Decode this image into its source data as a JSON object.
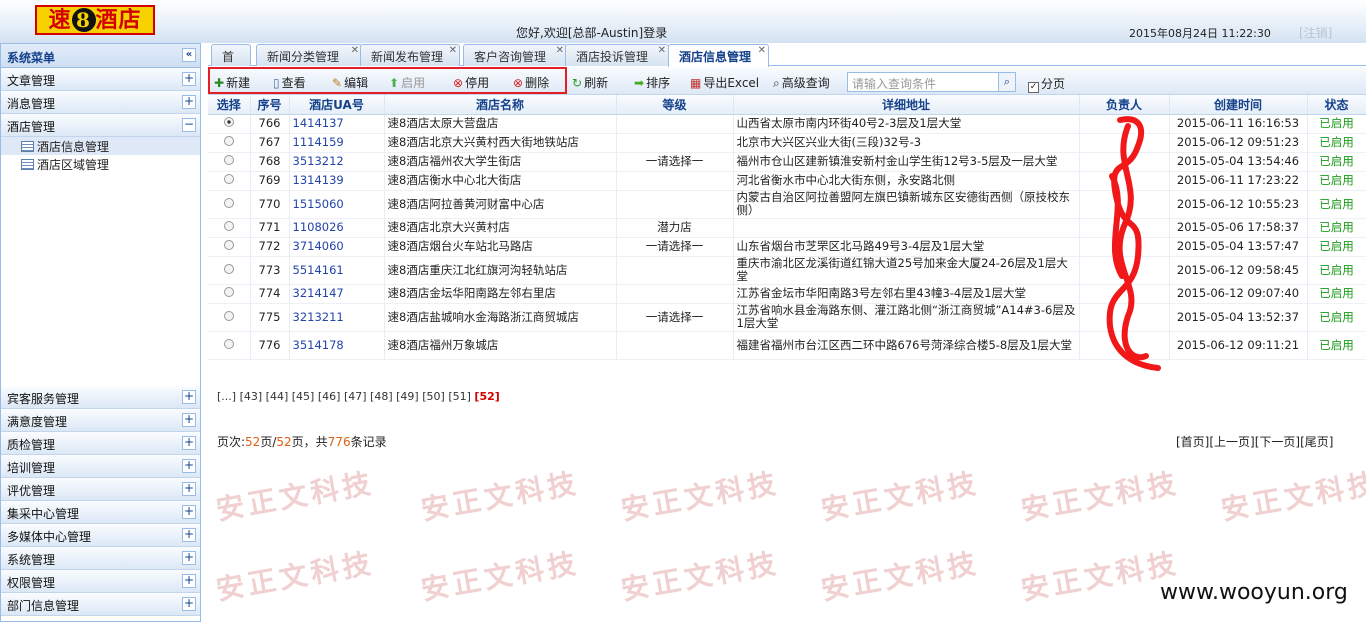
{
  "header": {
    "logo": {
      "pre": "速",
      "mid": "8",
      "post": "酒店"
    },
    "welcome": "您好,欢迎[总部-Austin]登录",
    "datetime": "2015年08月24日 11:22:30",
    "logout": "[注销]"
  },
  "sidebar": {
    "title": "系统菜单",
    "collapse_icon": "«",
    "top_items": [
      {
        "label": "文章管理",
        "icon": "+"
      },
      {
        "label": "消息管理",
        "icon": "+"
      },
      {
        "label": "酒店管理",
        "icon": "−"
      }
    ],
    "sub_items": [
      {
        "label": "酒店信息管理"
      },
      {
        "label": "酒店区域管理"
      }
    ],
    "bottom_items": [
      {
        "label": "宾客服务管理",
        "icon": "+"
      },
      {
        "label": "满意度管理",
        "icon": "+"
      },
      {
        "label": "质检管理",
        "icon": "+"
      },
      {
        "label": "培训管理",
        "icon": "+"
      },
      {
        "label": "评优管理",
        "icon": "+"
      },
      {
        "label": "集采中心管理",
        "icon": "+"
      },
      {
        "label": "多媒体中心管理",
        "icon": "+"
      },
      {
        "label": "系统管理",
        "icon": "+"
      },
      {
        "label": "权限管理",
        "icon": "+"
      },
      {
        "label": "部门信息管理",
        "icon": "+"
      }
    ]
  },
  "tabs": [
    {
      "label": "首页"
    },
    {
      "label": "新闻分类管理"
    },
    {
      "label": "新闻发布管理"
    },
    {
      "label": "客户咨询管理"
    },
    {
      "label": "酒店投诉管理"
    },
    {
      "label": "酒店信息管理"
    }
  ],
  "toolbar": {
    "new": "新建",
    "view": "查看",
    "edit": "编辑",
    "enable": "启用",
    "disable": "停用",
    "delete": "删除",
    "refresh": "刷新",
    "sort": "排序",
    "export": "导出Excel",
    "advanced": "高级查询",
    "search_placeholder": "请输入查询条件",
    "paging": "分页"
  },
  "table": {
    "columns": [
      "选择",
      "序号",
      "酒店UA号",
      "酒店名称",
      "等级",
      "详细地址",
      "负责人",
      "创建时间",
      "状态"
    ],
    "rows": [
      {
        "no": "766",
        "ua": "1414137",
        "name": "速8酒店太原大营盘店",
        "level": "",
        "addr": "山西省太原市南内环街40号2-3层及1层大堂",
        "time": "2015-06-11 16:16:53",
        "status": "已启用"
      },
      {
        "no": "767",
        "ua": "1114159",
        "name": "速8酒店北京大兴黄村西大街地铁站店",
        "level": "",
        "addr": "北京市大兴区兴业大街(三段)32号-3",
        "time": "2015-06-12 09:51:23",
        "status": "已启用"
      },
      {
        "no": "768",
        "ua": "3513212",
        "name": "速8酒店福州农大学生街店",
        "level": "一请选择一",
        "addr": "福州市仓山区建新镇淮安新村金山学生街12号3-5层及一层大堂",
        "time": "2015-05-04 13:54:46",
        "status": "已启用"
      },
      {
        "no": "769",
        "ua": "1314139",
        "name": "速8酒店衡水中心北大街店",
        "level": "",
        "addr": "河北省衡水市中心北大街东侧，永安路北侧",
        "time": "2015-06-11 17:23:22",
        "status": "已启用"
      },
      {
        "no": "770",
        "ua": "1515060",
        "name": "速8酒店阿拉善黄河财富中心店",
        "level": "",
        "addr": "内蒙古自治区阿拉善盟阿左旗巴镇新城东区安德街西侧（原技校东侧）",
        "time": "2015-06-12 10:55:23",
        "status": "已启用"
      },
      {
        "no": "771",
        "ua": "1108026",
        "name": "速8酒店北京大兴黄村店",
        "level": "潜力店",
        "addr": "",
        "time": "2015-05-06 17:58:37",
        "status": "已启用"
      },
      {
        "no": "772",
        "ua": "3714060",
        "name": "速8酒店烟台火车站北马路店",
        "level": "一请选择一",
        "addr": "山东省烟台市芝罘区北马路49号3-4层及1层大堂",
        "time": "2015-05-04 13:57:47",
        "status": "已启用"
      },
      {
        "no": "773",
        "ua": "5514161",
        "name": "速8酒店重庆江北红旗河沟轻轨站店",
        "level": "",
        "addr": "重庆市渝北区龙溪街道红锦大道25号加来金大厦24-26层及1层大堂",
        "time": "2015-06-12 09:58:45",
        "status": "已启用"
      },
      {
        "no": "774",
        "ua": "3214147",
        "name": "速8酒店金坛华阳南路左邻右里店",
        "level": "",
        "addr": "江苏省金坛市华阳南路3号左邻右里43幢3-4层及1层大堂",
        "time": "2015-06-12 09:07:40",
        "status": "已启用"
      },
      {
        "no": "775",
        "ua": "3213211",
        "name": "速8酒店盐城响水金海路浙江商贸城店",
        "level": "一请选择一",
        "addr": "江苏省响水县金海路东侧、灌江路北侧“浙江商贸城”A14#3-6层及1层大堂",
        "time": "2015-05-04 13:52:37",
        "status": "已启用"
      },
      {
        "no": "776",
        "ua": "3514178",
        "name": "速8酒店福州万象城店",
        "level": "",
        "addr": "福建省福州市台江区西二环中路676号菏泽综合楼5-8层及1层大堂",
        "time": "2015-06-12 09:11:21",
        "status": "已启用"
      }
    ]
  },
  "pager": {
    "numbers": [
      "[...]",
      "[43]",
      "[44]",
      "[45]",
      "[46]",
      "[47]",
      "[48]",
      "[49]",
      "[50]",
      "[51]"
    ],
    "current": "[52]",
    "info_prefix": "页次:",
    "cur_page": "52",
    "info_mid1": "页/",
    "total_pages": "52",
    "info_mid2": "页，共",
    "total_records": "776",
    "info_suffix": "条记录",
    "first": "[首页]",
    "prev": "[上一页]",
    "next": "[下一页]",
    "last": "[尾页]"
  },
  "watermark": "安正文科技",
  "site_mark": "www.wooyun.org",
  "colors": {
    "accent": "#15428b",
    "border": "#99bbe8",
    "enabled": "#1a9a1a",
    "highlight_box": "#e31e24"
  }
}
